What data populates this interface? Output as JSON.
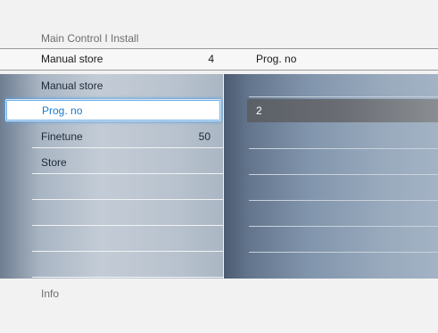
{
  "breadcrumb": "Main Control I Install",
  "header": {
    "left_label": "Manual store",
    "left_value": "4",
    "right_label": "Prog. no"
  },
  "menu": {
    "title": "Manual store",
    "items": [
      {
        "label": "Prog. no",
        "value": ""
      },
      {
        "label": "Finetune",
        "value": "50"
      },
      {
        "label": "Store",
        "value": ""
      }
    ]
  },
  "options": {
    "selected_value": "2"
  },
  "info_label": "Info",
  "colors": {
    "highlight_text": "#1c78cc",
    "selection_glow": "#6fb1ee"
  }
}
